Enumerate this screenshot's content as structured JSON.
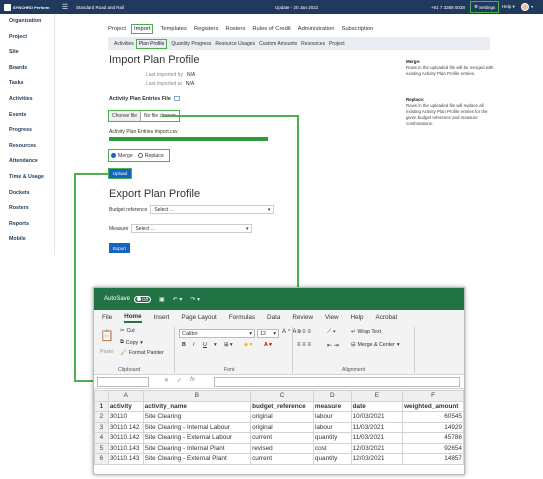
{
  "topbar": {
    "logo_text": "SYNCHRO Perform",
    "company": "Standard Road and Rail",
    "update": "Update - 20 Jan 2022",
    "phone": "+61 7 3368 0038",
    "settings_label": "Settings",
    "help_label": "Help"
  },
  "sidebar": {
    "items": [
      "Organization",
      "Project",
      "Site",
      "Boards",
      "Tasks",
      "Activities",
      "Events",
      "Progress",
      "Resources",
      "Attendance",
      "Time & Usage",
      "Dockets",
      "Rosters",
      "Reports",
      "Mobile"
    ]
  },
  "nav": {
    "tabs": [
      "Project",
      "Import",
      "Templates",
      "Registers",
      "Rosters",
      "Rules of Credit",
      "Administration",
      "Subscription"
    ],
    "active": "Import",
    "subtabs": [
      "Activities",
      "Plan Profile",
      "Quantity Progress",
      "Resource Usages",
      "Custom Amounts",
      "Resources",
      "Project"
    ],
    "active_sub": "Plan Profile"
  },
  "import": {
    "title": "Import Plan Profile",
    "last_imported_by_label": "Last imported by",
    "last_imported_by": "N/A",
    "last_imported_at_label": "Last imported at",
    "last_imported_at": "N/A",
    "file_label": "Activity Plan Entries File",
    "choose_file": "Choose file",
    "no_file": "No file chosen",
    "filename": "Activity Plan Entries Import.csv",
    "progress": 1.0,
    "merge_label": "Merge",
    "replace_label": "Replace",
    "selected": "Merge",
    "upload_label": "Upload"
  },
  "export": {
    "title": "Export Plan Profile",
    "budget_label": "Budget reference",
    "budget_value": "Select ...",
    "measure_label": "Measure",
    "measure_value": "Select ...",
    "export_label": "Export"
  },
  "notes": {
    "merge_title": "Merge:",
    "merge_text": "Rows in the uploaded file will be merged with existing Activity Plan Profile entries.",
    "replace_title": "Replace:",
    "replace_text": "Rows in the uploaded file will replace all existing Activity Plan Profile entries for the given budget reference and measure combinations."
  },
  "excel": {
    "autosave": "AutoSave",
    "toggle": "Off",
    "tabs": [
      "File",
      "Home",
      "Insert",
      "Page Layout",
      "Formulas",
      "Data",
      "Review",
      "View",
      "Help",
      "Acrobat"
    ],
    "active_tab": "Home",
    "clipboard": {
      "cut": "Cut",
      "copy": "Copy",
      "format_painter": "Format Painter",
      "paste": "Paste",
      "label": "Clipboard"
    },
    "font": {
      "name": "Calibri",
      "size": "12",
      "label": "Font",
      "bold": "B",
      "italic": "I",
      "underline": "U"
    },
    "alignment": {
      "wrap": "Wrap Text",
      "merge": "Merge & Center",
      "label": "Alignment"
    },
    "fx": "fx",
    "columns": [
      "A",
      "B",
      "C",
      "D",
      "E",
      "F"
    ],
    "rows": [
      [
        "activity",
        "activity_name",
        "budget_reference",
        "measure",
        "date",
        "weighted_amount"
      ],
      [
        "30110",
        "Site Clearing",
        "original",
        "labour",
        "10/03/2021",
        "60545"
      ],
      [
        "30110.142",
        "Site Clearing - Internal Labour",
        "original",
        "labour",
        "11/03/2021",
        "14929"
      ],
      [
        "30110.142",
        "Site Clearing - External Labour",
        "current",
        "quantity",
        "11/03/2021",
        "45786"
      ],
      [
        "30110.143",
        "Site Clearing - Internal Plant",
        "revised",
        "cost",
        "12/03/2021",
        "92654"
      ],
      [
        "30110.143",
        "Site Clearing - External Plant",
        "current",
        "quantity",
        "12/03/2021",
        "14857"
      ]
    ]
  },
  "colors": {
    "nav": "#1f3a5c",
    "highlight": "#4caf50",
    "button": "#1565c0",
    "excel": "#217346"
  }
}
